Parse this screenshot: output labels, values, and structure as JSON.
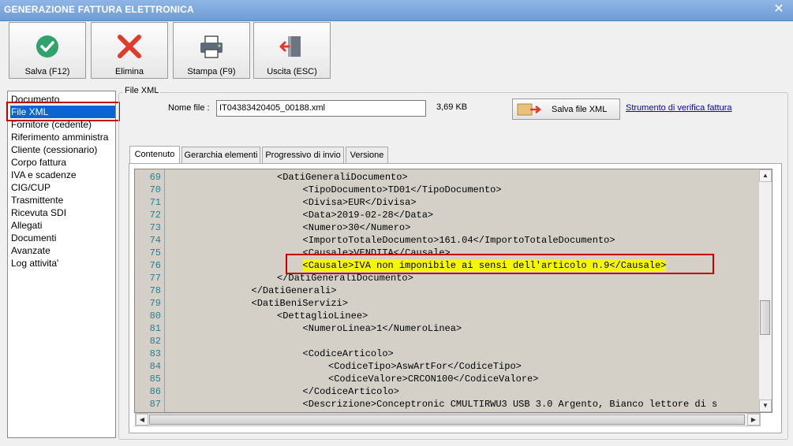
{
  "window": {
    "title": "GENERAZIONE FATTURA ELETTRONICA",
    "close_glyph": "✕"
  },
  "toolbar": {
    "save_label": "Salva (F12)",
    "delete_label": "Elimina",
    "print_label": "Stampa (F9)",
    "exit_label": "Uscita (ESC)"
  },
  "sidebar": {
    "items": [
      {
        "label": "Documento"
      },
      {
        "label": "File XML"
      },
      {
        "label": "Fornitore (cedente)"
      },
      {
        "label": "Riferimento amministra"
      },
      {
        "label": "Cliente (cessionario)"
      },
      {
        "label": "Corpo fattura"
      },
      {
        "label": "IVA e scadenze"
      },
      {
        "label": "CIG/CUP"
      },
      {
        "label": "Trasmittente"
      },
      {
        "label": "Ricevuta SDI"
      },
      {
        "label": "Allegati"
      },
      {
        "label": "Documenti"
      },
      {
        "label": "Avanzate"
      },
      {
        "label": "Log attivita'"
      }
    ],
    "selected_index": 1
  },
  "file_xml": {
    "group_title": "File XML",
    "name_label": "Nome file :",
    "name_value": "IT04383420405_00188.xml",
    "size": "3,69 KB",
    "save_button": "Salva file XML",
    "verify_link": "Strumento di verifica fattura"
  },
  "tabs": [
    {
      "label": "Contenuto",
      "active": true
    },
    {
      "label": "Gerarchia elementi",
      "active": false
    },
    {
      "label": "Progressivo di invio",
      "active": false
    },
    {
      "label": "Versione",
      "active": false
    }
  ],
  "editor": {
    "lines": [
      {
        "num": "69",
        "text": "<DatiGeneraliDocumento>",
        "indent": 4
      },
      {
        "num": "70",
        "text": "<TipoDocumento>TD01</TipoDocumento>",
        "indent": 5
      },
      {
        "num": "71",
        "text": "<Divisa>EUR</Divisa>",
        "indent": 5
      },
      {
        "num": "72",
        "text": "<Data>2019-02-28</Data>",
        "indent": 5
      },
      {
        "num": "73",
        "text": "<Numero>30</Numero>",
        "indent": 5
      },
      {
        "num": "74",
        "text": "<ImportoTotaleDocumento>161.04</ImportoTotaleDocumento>",
        "indent": 5
      },
      {
        "num": "75",
        "text": "<Causale>VENDITA</Causale>",
        "indent": 5
      },
      {
        "num": "76",
        "text": "<Causale>IVA non imponibile ai sensi dell'articolo n.9</Causale>",
        "indent": 5,
        "highlight": true
      },
      {
        "num": "77",
        "text": "</DatiGeneraliDocumento>",
        "indent": 4
      },
      {
        "num": "78",
        "text": "</DatiGenerali>",
        "indent": 3
      },
      {
        "num": "79",
        "text": "<DatiBeniServizi>",
        "indent": 3
      },
      {
        "num": "80",
        "text": "<DettaglioLinee>",
        "indent": 4
      },
      {
        "num": "81",
        "text": "<NumeroLinea>1</NumeroLinea>",
        "indent": 5
      },
      {
        "num": "82",
        "text": "",
        "indent": 5
      },
      {
        "num": "83",
        "text": "<CodiceArticolo>",
        "indent": 5
      },
      {
        "num": "84",
        "text": "<CodiceTipo>AswArtFor</CodiceTipo>",
        "indent": 6
      },
      {
        "num": "85",
        "text": "<CodiceValore>CRCON100</CodiceValore>",
        "indent": 6
      },
      {
        "num": "86",
        "text": "</CodiceArticolo>",
        "indent": 5
      },
      {
        "num": "87",
        "text": "<Descrizione>Conceptronic CMULTIRWU3 USB 3.0 Argento, Bianco lettore di s",
        "indent": 5
      }
    ]
  }
}
